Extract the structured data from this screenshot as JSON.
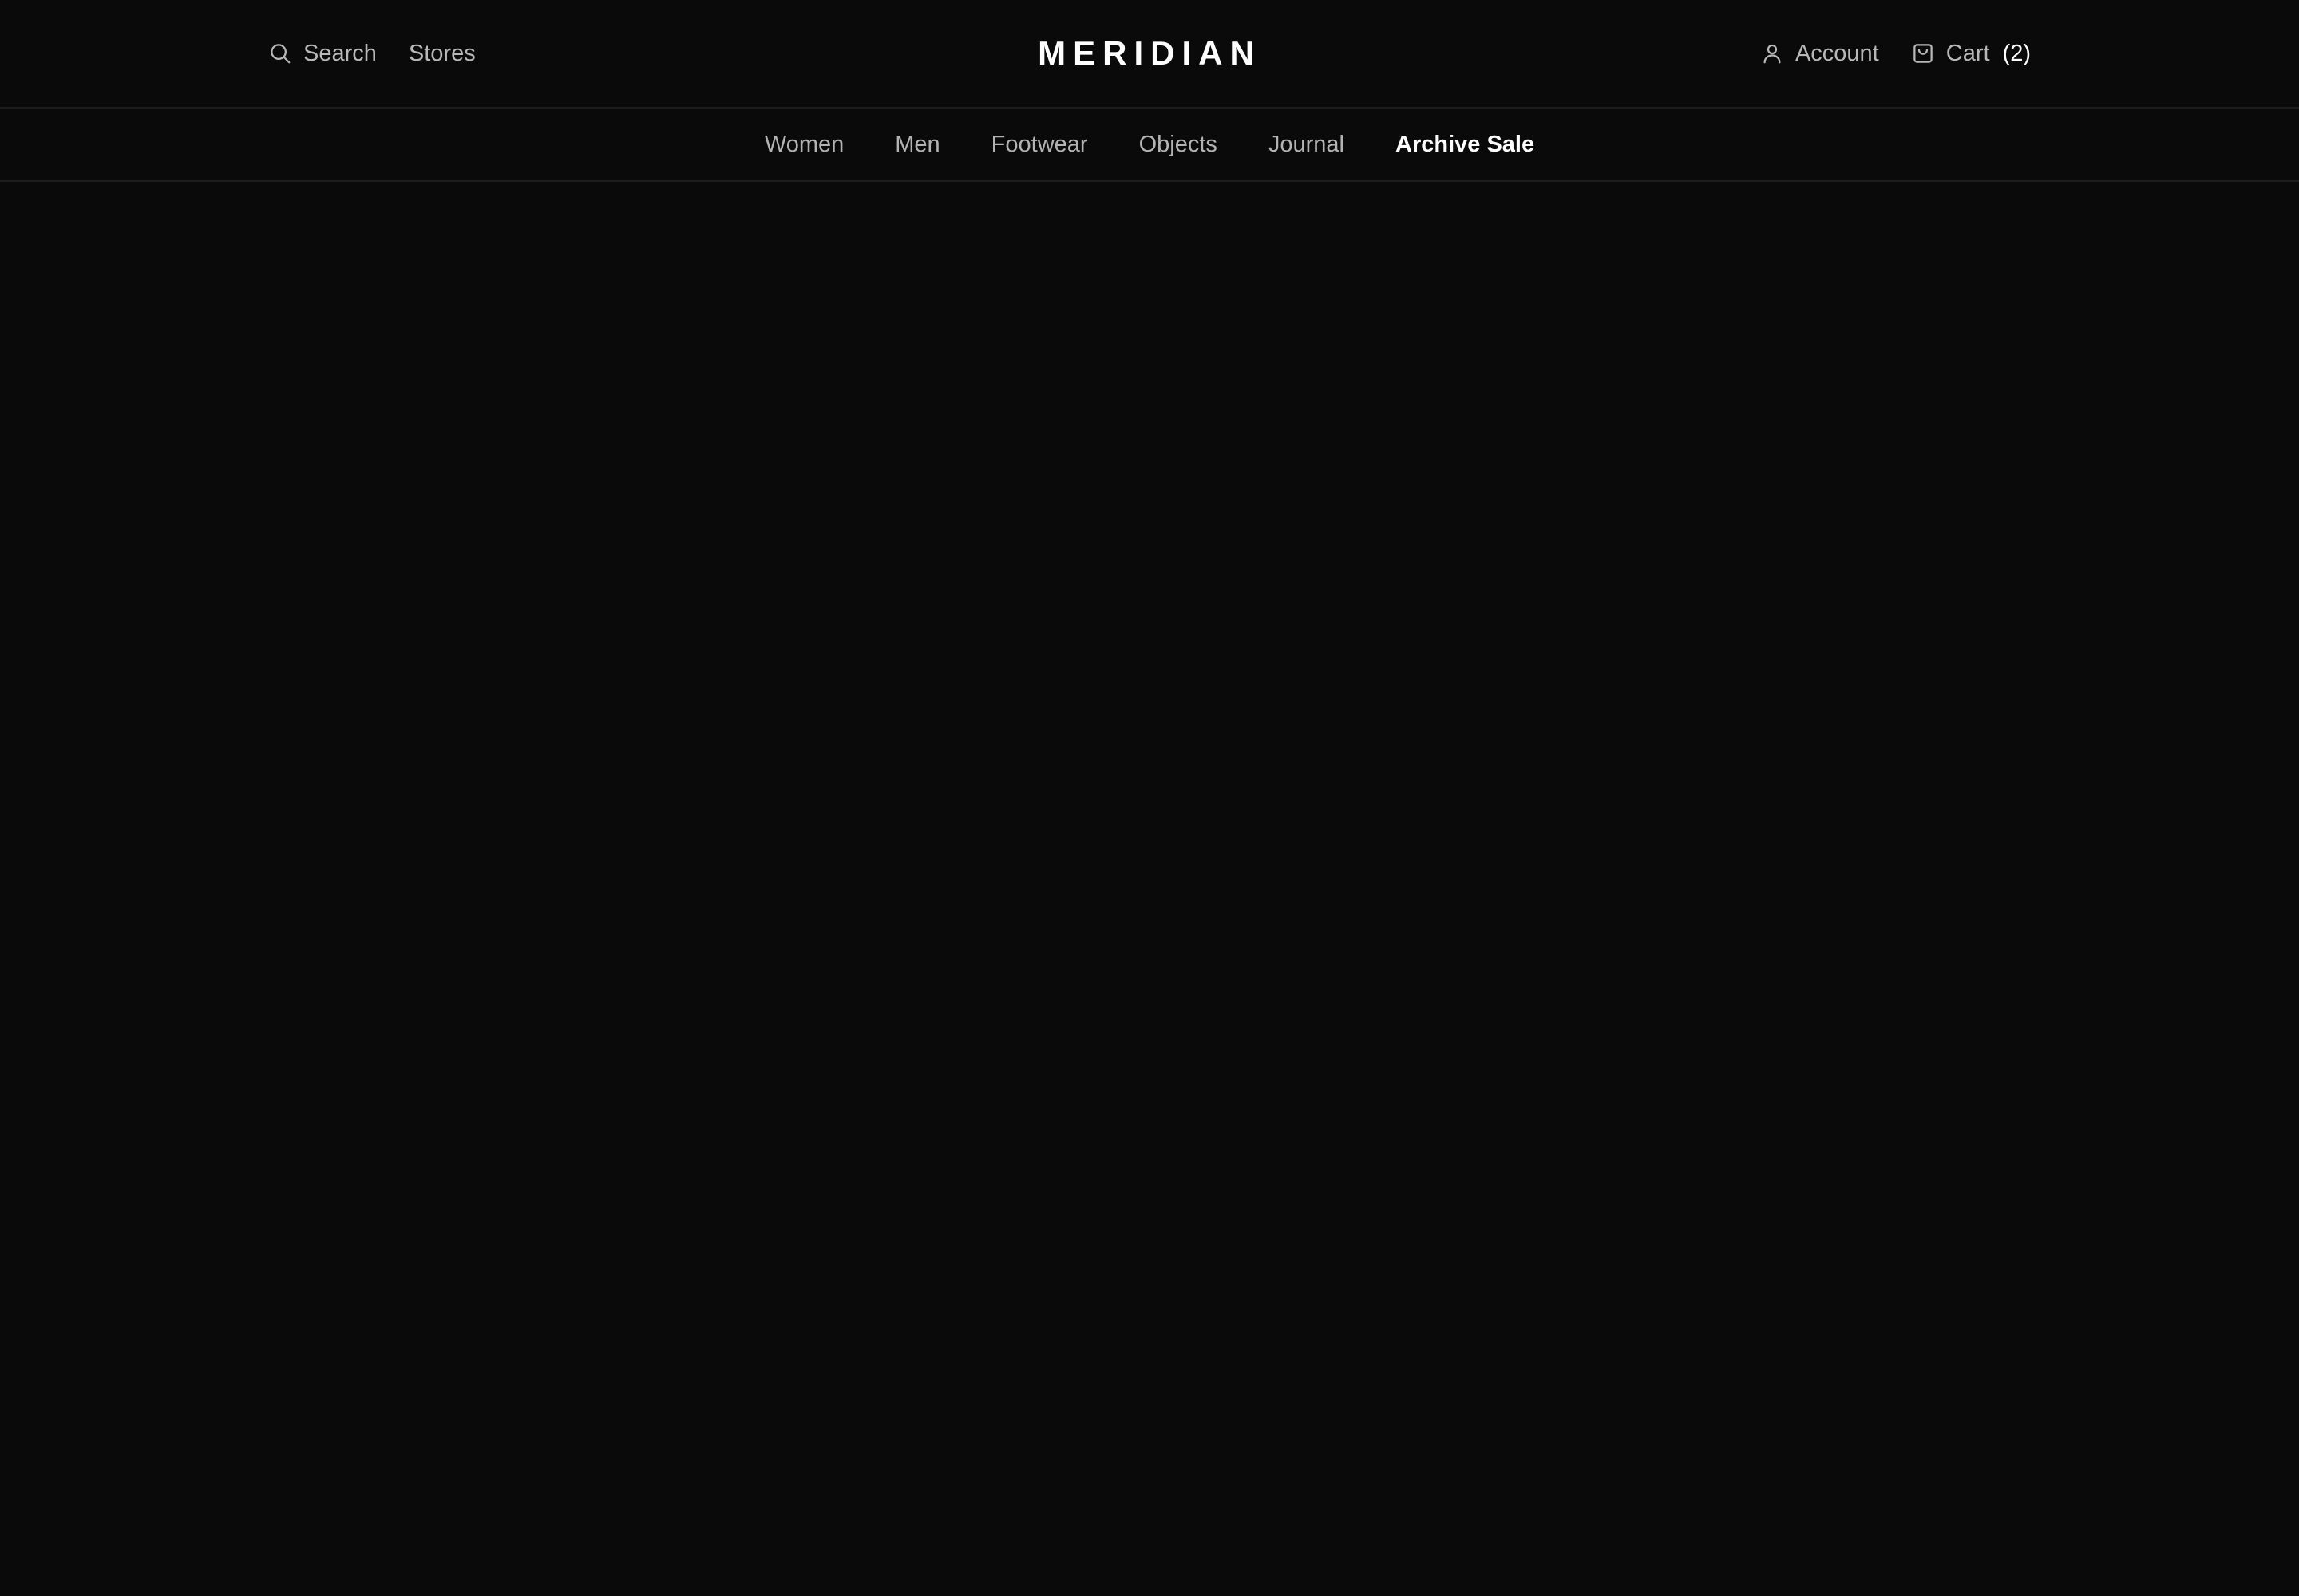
{
  "header": {
    "search_label": "Search",
    "search_icon": "search-icon",
    "stores_label": "Stores",
    "brand": "MERIDIAN",
    "account_label": "Account",
    "account_icon": "user-icon",
    "cart_label": "Cart",
    "cart_icon": "shopping-bag-icon",
    "cart_count": "(2)"
  },
  "nav": {
    "items": [
      {
        "label": "Women"
      },
      {
        "label": "Men"
      },
      {
        "label": "Footwear"
      },
      {
        "label": "Objects"
      },
      {
        "label": "Journal"
      },
      {
        "label": "Archive Sale",
        "active": true
      }
    ]
  },
  "colors": {
    "background": "#0a0a0a",
    "text_muted": "#b8b8b8",
    "text_active": "#ffffff",
    "divider": "#1c1c1c"
  }
}
